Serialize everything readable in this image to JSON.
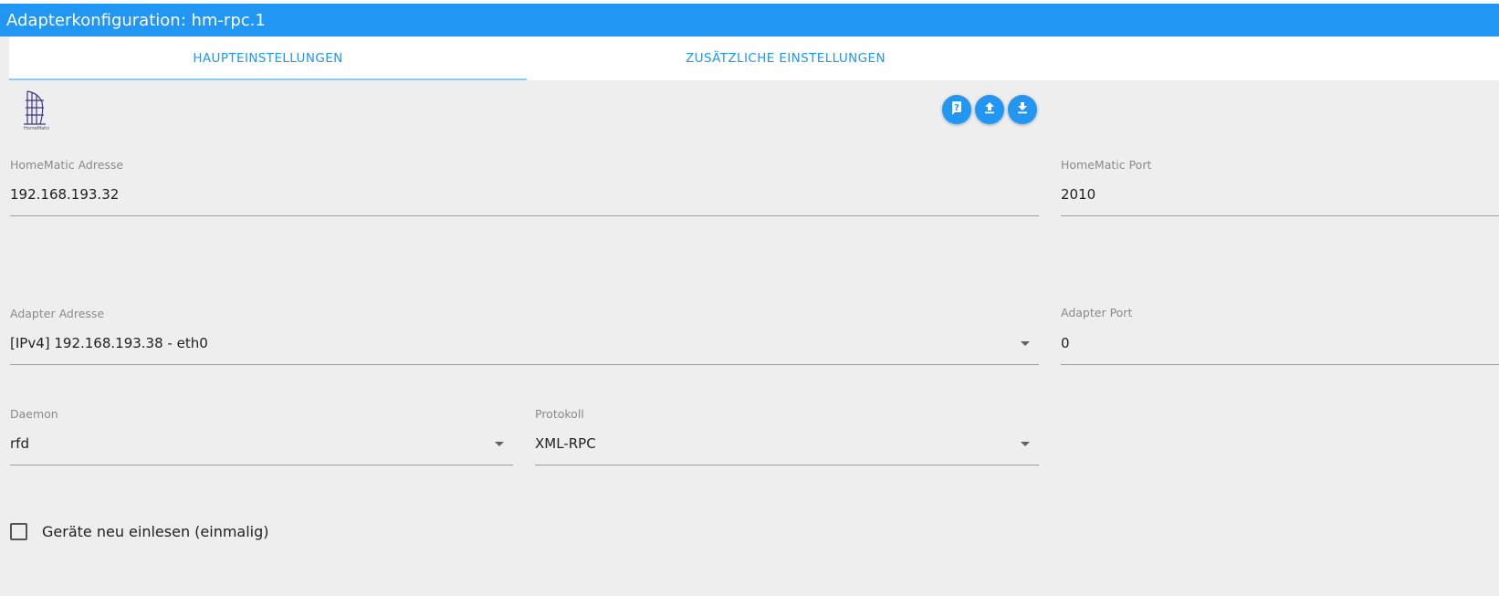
{
  "window": {
    "title": "Adapterkonfiguration: hm-rpc.1"
  },
  "tabs": [
    {
      "label": "HAUPTEINSTELLUNGEN",
      "active": true
    },
    {
      "label": "ZUSÄTZLICHE EINSTELLUNGEN",
      "active": false
    }
  ],
  "logo": {
    "icon": "homematic-logo-icon"
  },
  "actions": [
    {
      "icon": "help-icon"
    },
    {
      "icon": "upload-icon"
    },
    {
      "icon": "download-icon"
    }
  ],
  "fields": {
    "homematic_address": {
      "label": "HomeMatic Adresse",
      "value": "192.168.193.32"
    },
    "homematic_port": {
      "label": "HomeMatic Port",
      "value": "2010"
    },
    "adapter_address": {
      "label": "Adapter Adresse",
      "value": "[IPv4] 192.168.193.38 - eth0"
    },
    "adapter_port": {
      "label": "Adapter Port",
      "value": "0"
    },
    "daemon": {
      "label": "Daemon",
      "value": "rfd"
    },
    "protocol": {
      "label": "Protokoll",
      "value": "XML-RPC"
    }
  },
  "checkbox": {
    "label": "Geräte neu einlesen (einmalig)",
    "checked": false
  },
  "colors": {
    "accent": "#2196f3",
    "background": "#eeeeee",
    "tab_indicator": "#90caf9"
  }
}
